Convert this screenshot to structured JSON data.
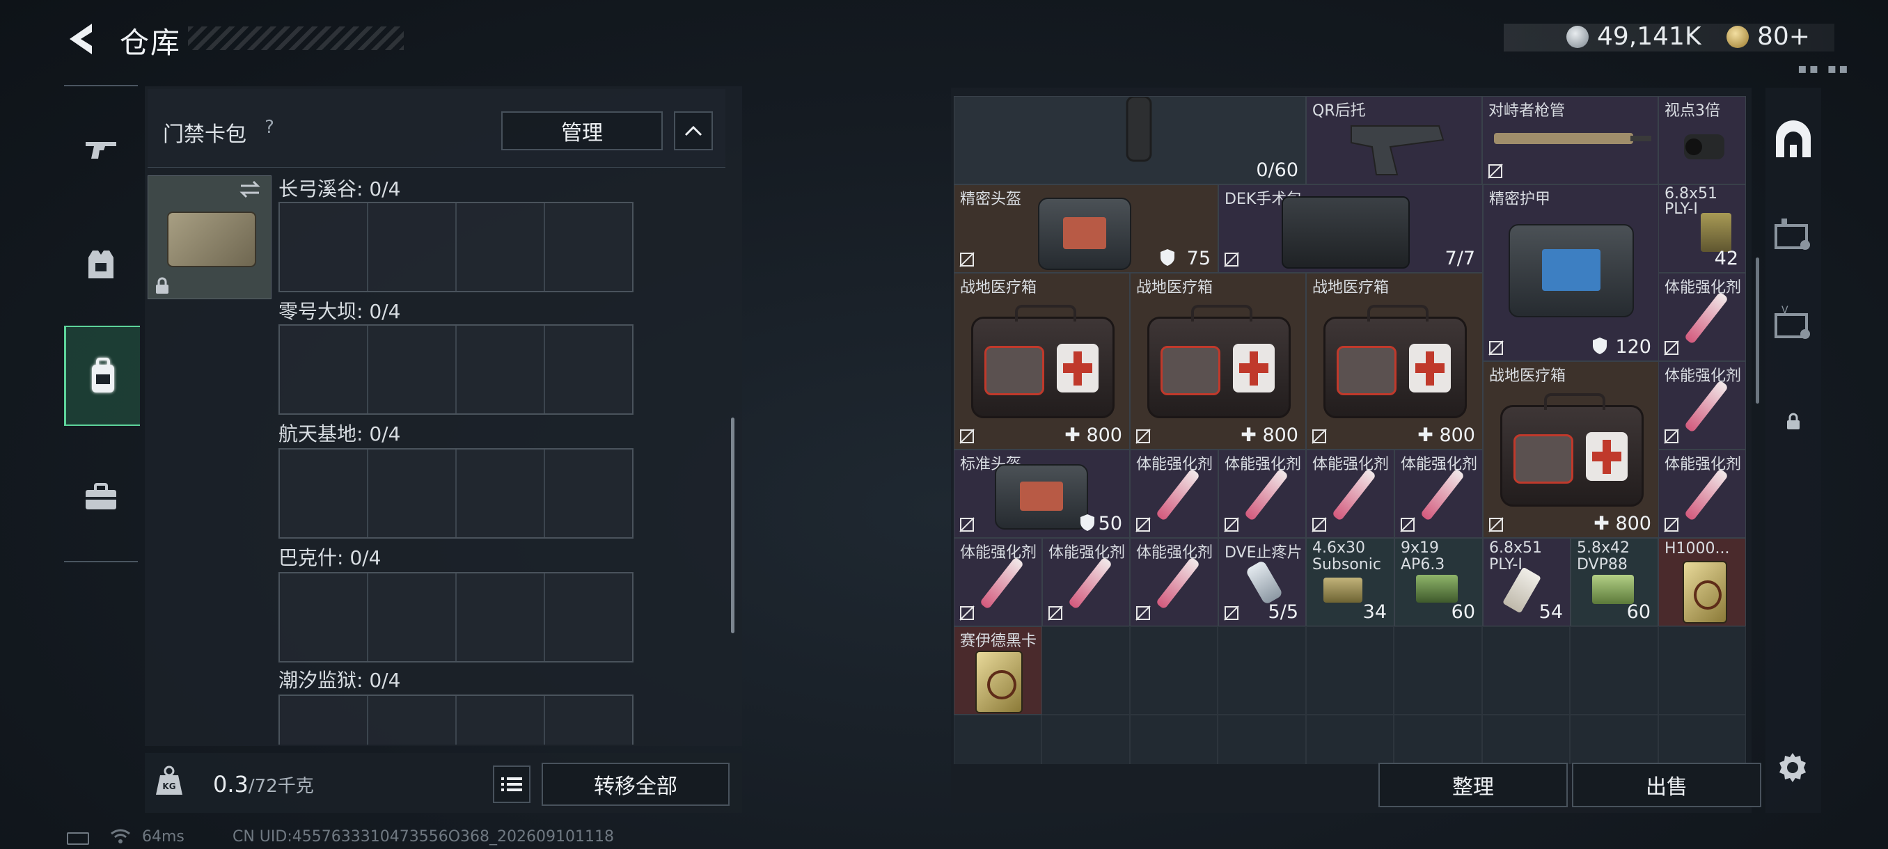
{
  "header": {
    "title": "仓库",
    "currency_amount": "49,141K",
    "token_amount": "80+",
    "signal_text": "▪▪ ▪▪"
  },
  "left_nav": {
    "items": [
      {
        "name": "weapons",
        "icon": "gun-icon"
      },
      {
        "name": "gear",
        "icon": "vest-icon"
      },
      {
        "name": "backpack",
        "icon": "backpack-icon",
        "active": true
      },
      {
        "name": "toolbox",
        "icon": "toolbox-icon"
      }
    ]
  },
  "keycard_panel": {
    "title": "门禁卡包",
    "help": "?",
    "manage_label": "管理",
    "slots": [
      {
        "label": "长弓溪谷: 0/4"
      },
      {
        "label": "零号大坝: 0/4"
      },
      {
        "label": "航天基地: 0/4"
      },
      {
        "label": "巴克什: 0/4"
      },
      {
        "label": "潮汐监狱: 0/4"
      }
    ]
  },
  "left_footer": {
    "weight": "0.3",
    "weight_max": "/72千克",
    "transfer_label": "转移全部"
  },
  "status_bar": {
    "ping": "64ms",
    "uid": "CN UID:4557633310473556O368_202609101118"
  },
  "inventory": {
    "items": [
      {
        "name": "",
        "qty": "0/60"
      },
      {
        "name": "QR后托",
        "qty": ""
      },
      {
        "name": "对峙者枪管",
        "qty": ""
      },
      {
        "name": "视点3倍",
        "qty": ""
      },
      {
        "name": "精密头盔",
        "qty": "75"
      },
      {
        "name": "DEK手术包",
        "qty": "7/7"
      },
      {
        "name": "精密护甲",
        "qty": "120"
      },
      {
        "name": "6.8x51 PLY-I",
        "qty": "42"
      },
      {
        "name": "战地医疗箱",
        "qty": "800"
      },
      {
        "name": "战地医疗箱",
        "qty": "800"
      },
      {
        "name": "战地医疗箱",
        "qty": "800"
      },
      {
        "name": "体能强化剂",
        "qty": ""
      },
      {
        "name": "战地医疗箱",
        "qty": "800"
      },
      {
        "name": "体能强化剂",
        "qty": ""
      },
      {
        "name": "标准头盔",
        "qty": "50"
      },
      {
        "name": "体能强化剂",
        "qty": ""
      },
      {
        "name": "体能强化剂",
        "qty": ""
      },
      {
        "name": "体能强化剂",
        "qty": ""
      },
      {
        "name": "体能强化剂",
        "qty": ""
      },
      {
        "name": "体能强化剂",
        "qty": ""
      },
      {
        "name": "体能强化剂",
        "qty": ""
      },
      {
        "name": "体能强化剂",
        "qty": ""
      },
      {
        "name": "体能强化剂",
        "qty": ""
      },
      {
        "name": "DVE止疼片",
        "qty": "5/5"
      },
      {
        "name": "4.6x30 Subsonic",
        "qty": "34"
      },
      {
        "name": "9x19 AP6.3",
        "qty": "60"
      },
      {
        "name": "6.8x51 PLY-I",
        "qty": "54"
      },
      {
        "name": "5.8x42 DVP88",
        "qty": "60"
      },
      {
        "name": "H1000...",
        "qty": ""
      },
      {
        "name": "赛伊德黑卡",
        "qty": ""
      }
    ]
  },
  "right_footer": {
    "sort_label": "整理",
    "sell_label": "出售"
  },
  "colors": {
    "accent_green": "#5dd39a",
    "rare_brown": "#3d322b",
    "epic_purple": "#312c40",
    "legend_red": "#4a2a2c"
  }
}
